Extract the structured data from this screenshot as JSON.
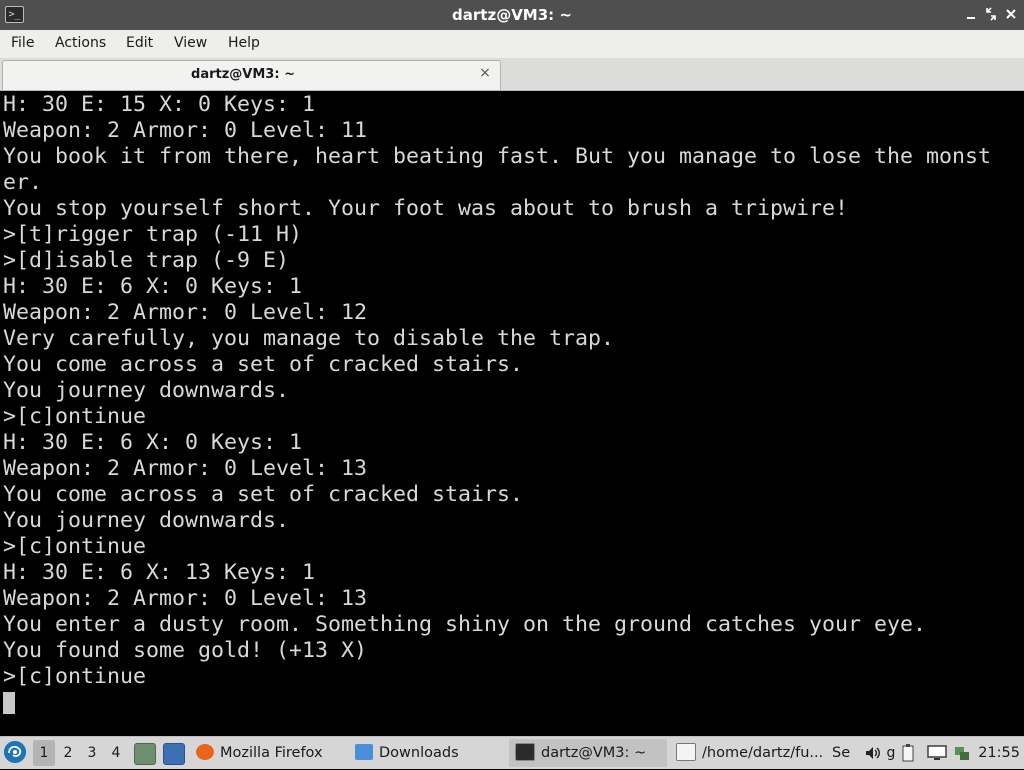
{
  "window": {
    "title": "dartz@VM3: ~",
    "terminal_glyph": ">_"
  },
  "menu": {
    "items": [
      "File",
      "Actions",
      "Edit",
      "View",
      "Help"
    ]
  },
  "tab": {
    "label": "dartz@VM3: ~",
    "close_glyph": "×"
  },
  "terminal": {
    "lines": [
      "H: 30 E: 15 X: 0 Keys: 1",
      "Weapon: 2 Armor: 0 Level: 11",
      "You book it from there, heart beating fast. But you manage to lose the monst",
      "er.",
      "You stop yourself short. Your foot was about to brush a tripwire!",
      ">[t]rigger trap (-11 H)",
      ">[d]isable trap (-9 E)",
      "H: 30 E: 6 X: 0 Keys: 1",
      "Weapon: 2 Armor: 0 Level: 12",
      "Very carefully, you manage to disable the trap.",
      "You come across a set of cracked stairs.",
      "You journey downwards.",
      ">[c]ontinue",
      "H: 30 E: 6 X: 0 Keys: 1",
      "Weapon: 2 Armor: 0 Level: 13",
      "You come across a set of cracked stairs.",
      "You journey downwards.",
      ">[c]ontinue",
      "H: 30 E: 6 X: 13 Keys: 1",
      "Weapon: 2 Armor: 0 Level: 13",
      "You enter a dusty room. Something shiny on the ground catches your eye.",
      "You found some gold! (+13 X)",
      ">[c]ontinue"
    ]
  },
  "taskbar": {
    "workspaces": [
      "1",
      "2",
      "3",
      "4"
    ],
    "active_workspace": "1",
    "tasks": {
      "firefox": "Mozilla Firefox",
      "downloads": "Downloads",
      "terminal": "dartz@VM3: ~",
      "editor": "/home/dartz/fu...",
      "overflow": "Se",
      "g": "g"
    },
    "clock": "21:55",
    "colors": {
      "start": "#1f73b7",
      "firefox": "#e8661c",
      "folder": "#4a90d9"
    }
  }
}
